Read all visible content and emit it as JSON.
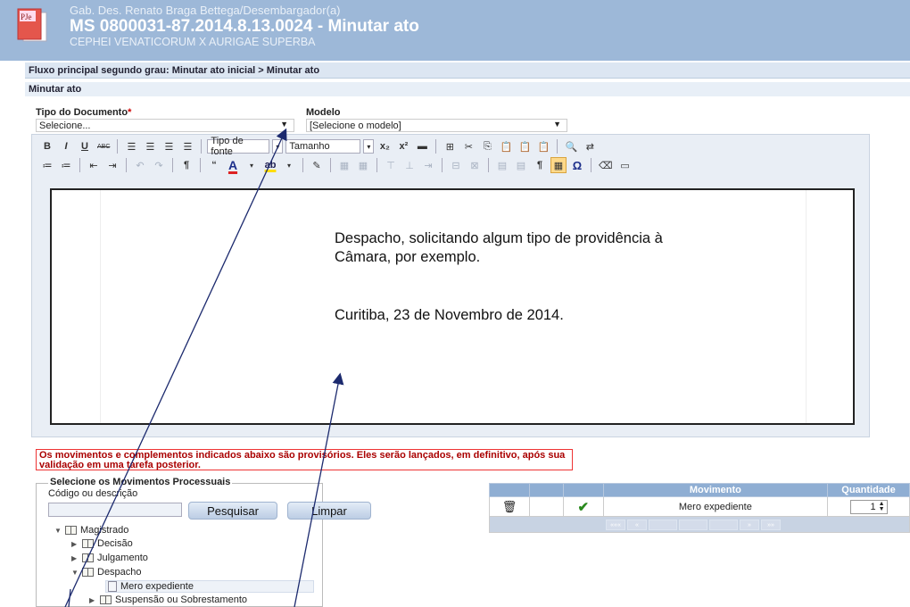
{
  "header": {
    "logo_text": "PJe",
    "court": "Gab. Des. Renato Braga Bettega/Desembargador(a)",
    "title": "MS 0800031-87.2014.8.13.0024 - Minutar ato",
    "parties": "CEPHEI VENATICORUM X AURIGAE SUPERBA"
  },
  "breadcrumb": "Fluxo principal segundo grau: Minutar ato inicial > Minutar ato",
  "section_title": "Minutar ato",
  "form": {
    "tipo_label": "Tipo do Documento",
    "required_mark": "*",
    "tipo_value": "Selecione...",
    "modelo_label": "Modelo",
    "modelo_value": "[Selecione o modelo]"
  },
  "toolbar": {
    "bold": "B",
    "italic": "I",
    "underline": "U",
    "strike": "ABC",
    "font_family": "Tipo de fonte",
    "font_size": "Tamanho",
    "quote": "“",
    "text_color": "A",
    "highlight": "ab",
    "paragraph": "¶",
    "omega": "Ω"
  },
  "editor": {
    "line1": "Despacho, solicitando algum tipo de providência à",
    "line2": "Câmara, por exemplo.",
    "line3": "Curitiba, 23 de Novembro de 2014."
  },
  "warning": "Os movimentos e complementos indicados abaixo são provisórios. Eles serão lançados, em definitivo, após sua validação em uma tarefa posterior.",
  "movements": {
    "legend": "Selecione os Movimentos Processuais",
    "search_label": "Código ou descrição",
    "search_value": "",
    "search_button": "Pesquisar",
    "clear_button": "Limpar",
    "tree": [
      {
        "label": "Magistrado"
      },
      {
        "label": "Decisão"
      },
      {
        "label": "Julgamento"
      },
      {
        "label": "Despacho"
      },
      {
        "label": "Mero expediente"
      },
      {
        "label": "Suspensão ou Sobrestamento"
      }
    ]
  },
  "grid": {
    "col_movimento": "Movimento",
    "col_quantidade": "Quantidade",
    "row_movimento": "Mero expediente",
    "row_quantidade": "1"
  },
  "colors": {
    "header_bg": "#9db8d8",
    "grid_header": "#8faed3",
    "warning_border": "#ee3333",
    "check": "#2a8a1e"
  }
}
